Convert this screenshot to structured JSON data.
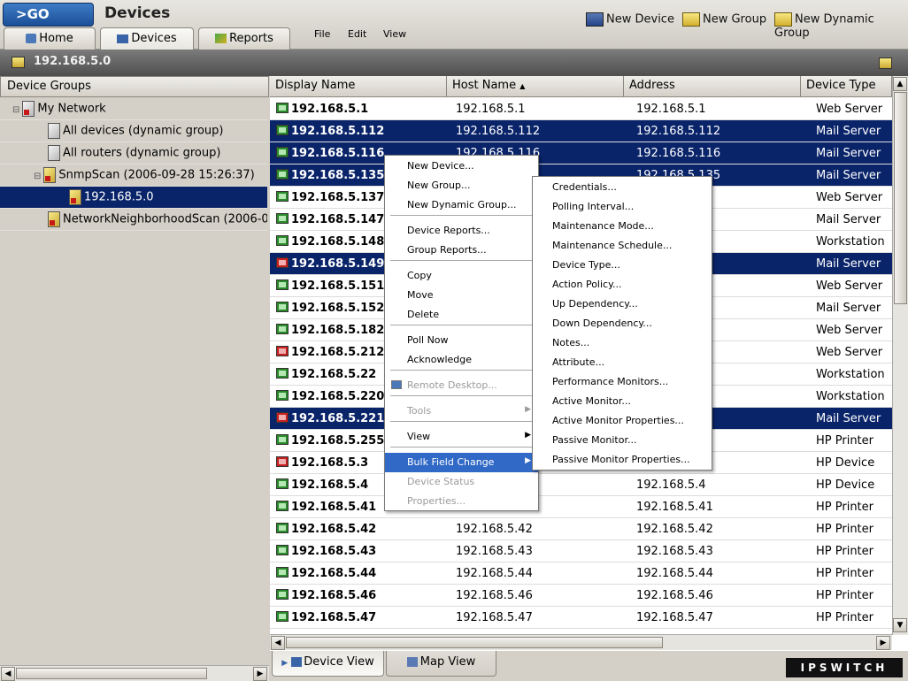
{
  "go_label": ">GO",
  "page_title": "Devices",
  "tabs": [
    {
      "label": "Home"
    },
    {
      "label": "Devices"
    },
    {
      "label": "Reports"
    }
  ],
  "menu": [
    "File",
    "Edit",
    "View"
  ],
  "toolbar": {
    "new_device": "New Device",
    "new_group": "New Group",
    "new_dynamic_group": "New Dynamic Group"
  },
  "path": "192.168.5.0",
  "tree": {
    "header": "Device Groups",
    "items": [
      {
        "label": "My Network"
      },
      {
        "label": "All devices (dynamic group)"
      },
      {
        "label": "All routers (dynamic group)"
      },
      {
        "label": "SnmpScan (2006-09-28 15:26:37)"
      },
      {
        "label": "192.168.5.0"
      },
      {
        "label": "NetworkNeighborhoodScan (2006-09-30"
      }
    ]
  },
  "table": {
    "columns": [
      "Display Name",
      "Host Name",
      "Address",
      "Device Type"
    ],
    "rows": [
      {
        "name": "192.168.5.1",
        "host": "192.168.5.1",
        "addr": "192.168.5.1",
        "type": "Web Server"
      },
      {
        "name": "192.168.5.112",
        "host": "192.168.5.112",
        "addr": "192.168.5.112",
        "type": "Mail Server"
      },
      {
        "name": "192.168.5.116",
        "host": "192.168.5.116",
        "addr": "192.168.5.116",
        "type": "Mail Server"
      },
      {
        "name": "192.168.5.135",
        "host": "",
        "addr": "192.168.5.135",
        "type": "Mail Server"
      },
      {
        "name": "192.168.5.137",
        "host": "",
        "addr": "",
        "type": "Web Server"
      },
      {
        "name": "192.168.5.147",
        "host": "",
        "addr": "",
        "type": "Mail Server"
      },
      {
        "name": "192.168.5.148",
        "host": "",
        "addr": "",
        "type": "Workstation"
      },
      {
        "name": "192.168.5.149",
        "host": "",
        "addr": "",
        "type": "Mail Server"
      },
      {
        "name": "192.168.5.151",
        "host": "",
        "addr": "",
        "type": "Web Server"
      },
      {
        "name": "192.168.5.152",
        "host": "",
        "addr": "",
        "type": "Mail Server"
      },
      {
        "name": "192.168.5.182",
        "host": "",
        "addr": "",
        "type": "Web Server"
      },
      {
        "name": "192.168.5.212",
        "host": "",
        "addr": "",
        "type": "Web Server"
      },
      {
        "name": "192.168.5.22",
        "host": "",
        "addr": "",
        "type": "Workstation"
      },
      {
        "name": "192.168.5.220",
        "host": "",
        "addr": "",
        "type": "Workstation"
      },
      {
        "name": "192.168.5.221",
        "host": "",
        "addr": "",
        "type": "Mail Server"
      },
      {
        "name": "192.168.5.255",
        "host": "",
        "addr": "",
        "type": "HP Printer"
      },
      {
        "name": "192.168.5.3",
        "host": "",
        "addr": "",
        "type": "HP Device"
      },
      {
        "name": "192.168.5.4",
        "host": "",
        "addr": "192.168.5.4",
        "type": "HP Device"
      },
      {
        "name": "192.168.5.41",
        "host": "",
        "addr": "192.168.5.41",
        "type": "HP Printer"
      },
      {
        "name": "192.168.5.42",
        "host": "192.168.5.42",
        "addr": "192.168.5.42",
        "type": "HP Printer"
      },
      {
        "name": "192.168.5.43",
        "host": "192.168.5.43",
        "addr": "192.168.5.43",
        "type": "HP Printer"
      },
      {
        "name": "192.168.5.44",
        "host": "192.168.5.44",
        "addr": "192.168.5.44",
        "type": "HP Printer"
      },
      {
        "name": "192.168.5.46",
        "host": "192.168.5.46",
        "addr": "192.168.5.46",
        "type": "HP Printer"
      },
      {
        "name": "192.168.5.47",
        "host": "192.168.5.47",
        "addr": "192.168.5.47",
        "type": "HP Printer"
      }
    ]
  },
  "context_menu": [
    {
      "label": "New Device..."
    },
    {
      "label": "New Group..."
    },
    {
      "label": "New Dynamic Group..."
    },
    {
      "label": "Device Reports..."
    },
    {
      "label": "Group Reports..."
    },
    {
      "label": "Copy"
    },
    {
      "label": "Move"
    },
    {
      "label": "Delete"
    },
    {
      "label": "Poll Now"
    },
    {
      "label": "Acknowledge"
    },
    {
      "label": "Remote Desktop..."
    },
    {
      "label": "Tools"
    },
    {
      "label": "View"
    },
    {
      "label": "Bulk Field Change"
    },
    {
      "label": "Device Status"
    },
    {
      "label": "Properties..."
    }
  ],
  "submenu": [
    {
      "label": "Credentials..."
    },
    {
      "label": "Polling Interval..."
    },
    {
      "label": "Maintenance Mode..."
    },
    {
      "label": "Maintenance Schedule..."
    },
    {
      "label": "Device Type..."
    },
    {
      "label": "Action Policy..."
    },
    {
      "label": "Up Dependency..."
    },
    {
      "label": "Down Dependency..."
    },
    {
      "label": "Notes..."
    },
    {
      "label": "Attribute..."
    },
    {
      "label": "Performance Monitors..."
    },
    {
      "label": "Active Monitor..."
    },
    {
      "label": "Active Monitor Properties..."
    },
    {
      "label": "Passive Monitor..."
    },
    {
      "label": "Passive Monitor Properties..."
    }
  ],
  "bottom_tabs": [
    {
      "label": "Device View"
    },
    {
      "label": "Map View"
    }
  ],
  "brand": "IPSWITCH",
  "colors": {
    "selection": "#0a246a",
    "menu_highlight": "#3169c6",
    "go_button": "#1b4f97"
  }
}
